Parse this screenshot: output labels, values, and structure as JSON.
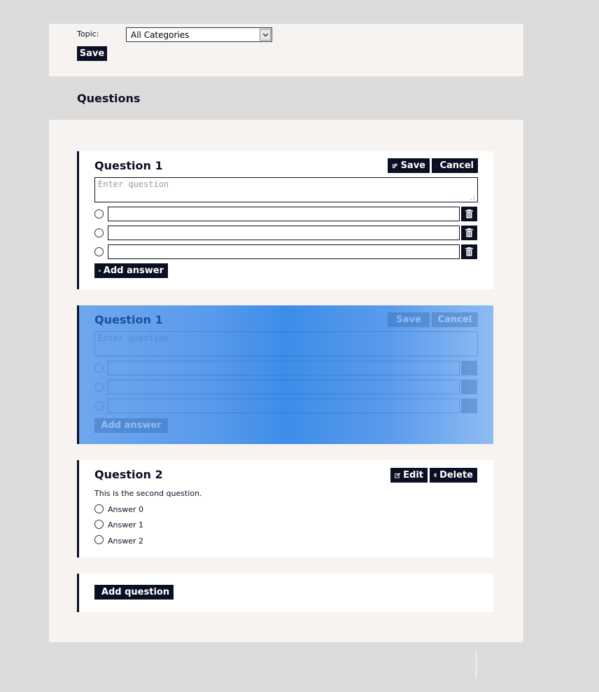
{
  "form": {
    "topic_label": "Topic:",
    "topic_value": "All Categories",
    "save_label": "Save"
  },
  "questions_heading": "Questions",
  "editor": {
    "title": "Question 1",
    "save_label": "Save",
    "cancel_label": "Cancel",
    "question_placeholder": "Enter question",
    "answers": [
      "",
      "",
      ""
    ],
    "add_answer_label": "Add answer"
  },
  "dragging": {
    "title": "Question 1",
    "save_label": "Save",
    "cancel_label": "Cancel",
    "question_placeholder": "Enter question",
    "add_answer_label": "Add answer"
  },
  "question2": {
    "title": "Question 2",
    "edit_label": "Edit",
    "delete_label": "Delete",
    "text": "This is the second question.",
    "answers": [
      "Answer 0",
      "Answer 1",
      "Answer 2"
    ]
  },
  "add_question_label": "Add question",
  "icons": {
    "save": "double-check-icon",
    "cancel": "x-icon",
    "trash": "trash-icon",
    "add": "plus-circle-icon",
    "edit": "edit-icon",
    "dropdown": "chevron-down-icon"
  },
  "colors": {
    "primary": "#0b0f24",
    "background": "#dcdcdc",
    "panel": "#f7f3f1",
    "drag_highlight": "#3d8de9"
  }
}
